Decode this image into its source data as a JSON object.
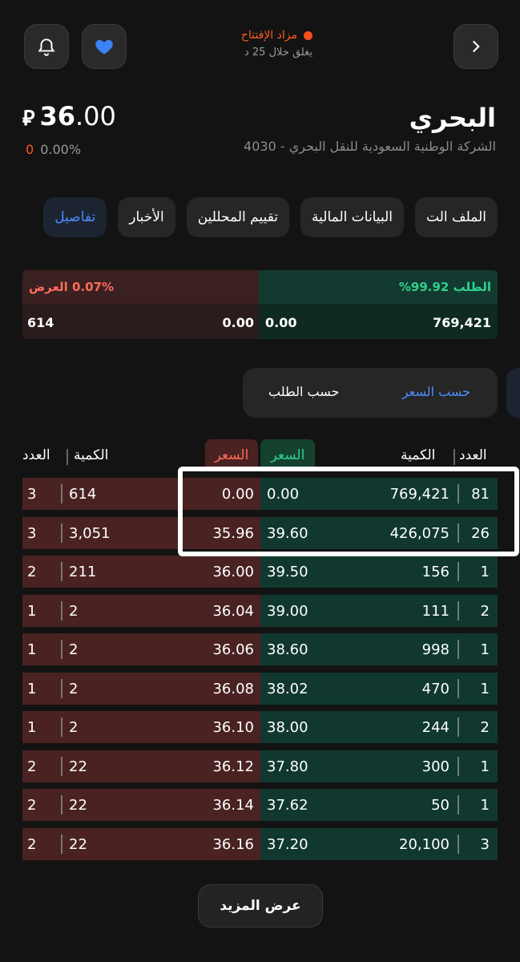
{
  "status": {
    "title": "مزاد الإفتتاح",
    "subtitle": "يغلق خلال 25 د"
  },
  "stock": {
    "name": "البحري",
    "description": "الشركة الوطنية السعودية للنقل البحري - 4030",
    "price_int": "36",
    "price_dec": ".00",
    "currency_symbol": "⃁",
    "change_value": "0",
    "change_percent": "0.00%"
  },
  "tabs": [
    "تفاصيل",
    "الأخبار",
    "تقييم المحللين",
    "البيانات المالية",
    "الملف الت"
  ],
  "summary": {
    "bid_label": "الطلب 99.92%",
    "ask_label": "0.07% العرض",
    "bid_qty": "769,421",
    "bid_price": "0.00",
    "ask_price": "0.00",
    "ask_qty": "614"
  },
  "toggle": {
    "by_price": "حسب السعر",
    "by_order": "حسب الطلب"
  },
  "headers": {
    "count_bid": "العدد",
    "qty_bid": "الكمية",
    "price_bid": "السعر",
    "price_ask": "السعر",
    "qty_ask": "الكمية",
    "count_ask": "العدد"
  },
  "rows": [
    {
      "ask_count": "3",
      "ask_qty": "614",
      "ask_price": "0.00",
      "bid_price": "0.00",
      "bid_qty": "769,421",
      "bid_count": "81"
    },
    {
      "ask_count": "3",
      "ask_qty": "3,051",
      "ask_price": "35.96",
      "bid_price": "39.60",
      "bid_qty": "426,075",
      "bid_count": "26"
    },
    {
      "ask_count": "2",
      "ask_qty": "211",
      "ask_price": "36.00",
      "bid_price": "39.50",
      "bid_qty": "156",
      "bid_count": "1"
    },
    {
      "ask_count": "1",
      "ask_qty": "2",
      "ask_price": "36.04",
      "bid_price": "39.00",
      "bid_qty": "111",
      "bid_count": "2"
    },
    {
      "ask_count": "1",
      "ask_qty": "2",
      "ask_price": "36.06",
      "bid_price": "38.60",
      "bid_qty": "998",
      "bid_count": "1"
    },
    {
      "ask_count": "1",
      "ask_qty": "2",
      "ask_price": "36.08",
      "bid_price": "38.02",
      "bid_qty": "470",
      "bid_count": "1"
    },
    {
      "ask_count": "1",
      "ask_qty": "2",
      "ask_price": "36.10",
      "bid_price": "38.00",
      "bid_qty": "244",
      "bid_count": "2"
    },
    {
      "ask_count": "2",
      "ask_qty": "22",
      "ask_price": "36.12",
      "bid_price": "37.80",
      "bid_qty": "300",
      "bid_count": "1"
    },
    {
      "ask_count": "2",
      "ask_qty": "22",
      "ask_price": "36.14",
      "bid_price": "37.62",
      "bid_qty": "50",
      "bid_count": "1"
    },
    {
      "ask_count": "2",
      "ask_qty": "22",
      "ask_price": "36.16",
      "bid_price": "37.20",
      "bid_qty": "20,100",
      "bid_count": "3"
    }
  ],
  "more_button": "عرض المزيد",
  "colors": {
    "bid": "#10382e",
    "ask": "#4a2222",
    "accent": "#4a8dff",
    "alert": "#ff5a1f"
  }
}
